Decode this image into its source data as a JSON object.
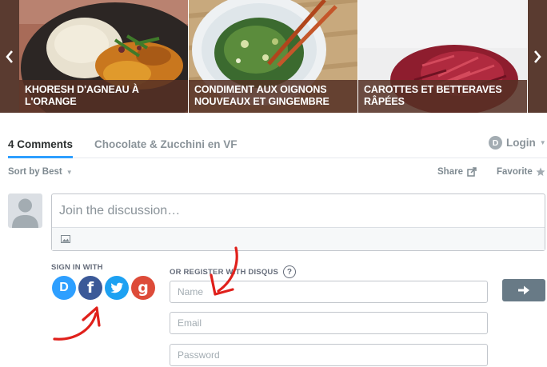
{
  "carousel": {
    "slides": [
      {
        "title": "KHORESH D'AGNEAU À L'ORANGE"
      },
      {
        "title": "CONDIMENT AUX OIGNONS NOUVEAUX ET GINGEMBRE"
      },
      {
        "title": "CAROTTES ET BETTERAVES RÂPÉES"
      }
    ]
  },
  "disqus": {
    "tab_comments": "4 Comments",
    "tab_community": "Chocolate & Zucchini en VF",
    "login_label": "Login",
    "login_logo": "D",
    "sort_label": "Sort by Best",
    "share_label": "Share",
    "favorite_label": "Favorite",
    "composer_placeholder": "Join the discussion…",
    "sign_in_label": "SIGN IN WITH",
    "register_label": "OR REGISTER WITH DISQUS",
    "help_label": "?",
    "social": [
      {
        "name": "disqus",
        "letter": "D",
        "color": "#2e9fff"
      },
      {
        "name": "facebook",
        "letter": "f",
        "color": "#3b5998"
      },
      {
        "name": "twitter",
        "letter": "",
        "color": "#1da1f2"
      },
      {
        "name": "google",
        "letter": "g",
        "color": "#dd4b39"
      }
    ],
    "fields": {
      "name_placeholder": "Name",
      "email_placeholder": "Email",
      "password_placeholder": "Password"
    }
  },
  "colors": {
    "accent": "#2e9fff",
    "caption_bg": "#553024",
    "annotation": "#e0201b",
    "submit": "#687a86"
  }
}
